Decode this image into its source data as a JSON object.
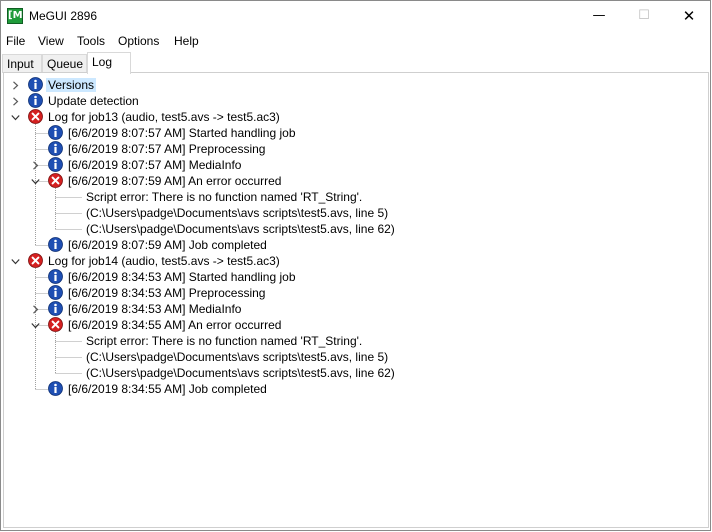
{
  "window": {
    "title": "MeGUI 2896",
    "app_icon_glyph": "[M]",
    "controls": {
      "minimize": "—",
      "maximize": "☐",
      "close": "✕"
    }
  },
  "menu": [
    "File",
    "View",
    "Tools",
    "Options",
    "Help"
  ],
  "tabs": [
    "Input",
    "Queue",
    "Log"
  ],
  "active_tab": "Log",
  "colors": {
    "info": "#1f4fb3",
    "error": "#d42020",
    "selection": "#cce8ff"
  },
  "tree": [
    {
      "label": "Versions",
      "icon": "info-icon",
      "expander": "collapsed",
      "level": 0,
      "selected": true
    },
    {
      "label": "Update detection",
      "icon": "info-icon",
      "expander": "collapsed",
      "level": 0
    },
    {
      "label": "Log for job13 (audio, test5.avs -> test5.ac3)",
      "icon": "error-icon",
      "expander": "expanded",
      "level": 0
    },
    {
      "label": "[6/6/2019 8:07:57 AM] Started handling job",
      "icon": "info-icon",
      "expander": "none",
      "level": 1
    },
    {
      "label": "[6/6/2019 8:07:57 AM] Preprocessing",
      "icon": "info-icon",
      "expander": "none",
      "level": 1
    },
    {
      "label": "[6/6/2019 8:07:57 AM] MediaInfo",
      "icon": "info-icon",
      "expander": "collapsed",
      "level": 1
    },
    {
      "label": "[6/6/2019 8:07:59 AM] An error occurred",
      "icon": "error-icon",
      "expander": "expanded",
      "level": 1
    },
    {
      "label": "Script error: There is no function named 'RT_String'.",
      "icon": "none",
      "expander": "none",
      "level": 2
    },
    {
      "label": "(C:\\Users\\padge\\Documents\\avs scripts\\test5.avs, line 5)",
      "icon": "none",
      "expander": "none",
      "level": 2
    },
    {
      "label": "(C:\\Users\\padge\\Documents\\avs scripts\\test5.avs, line 62)",
      "icon": "none",
      "expander": "none",
      "level": 2
    },
    {
      "label": "[6/6/2019 8:07:59 AM] Job completed",
      "icon": "info-icon",
      "expander": "none",
      "level": 1
    },
    {
      "label": "Log for job14 (audio, test5.avs -> test5.ac3)",
      "icon": "error-icon",
      "expander": "expanded",
      "level": 0
    },
    {
      "label": "[6/6/2019 8:34:53 AM] Started handling job",
      "icon": "info-icon",
      "expander": "none",
      "level": 1
    },
    {
      "label": "[6/6/2019 8:34:53 AM] Preprocessing",
      "icon": "info-icon",
      "expander": "none",
      "level": 1
    },
    {
      "label": "[6/6/2019 8:34:53 AM] MediaInfo",
      "icon": "info-icon",
      "expander": "collapsed",
      "level": 1
    },
    {
      "label": "[6/6/2019 8:34:55 AM] An error occurred",
      "icon": "error-icon",
      "expander": "expanded",
      "level": 1
    },
    {
      "label": "Script error: There is no function named 'RT_String'.",
      "icon": "none",
      "expander": "none",
      "level": 2
    },
    {
      "label": "(C:\\Users\\padge\\Documents\\avs scripts\\test5.avs, line 5)",
      "icon": "none",
      "expander": "none",
      "level": 2
    },
    {
      "label": "(C:\\Users\\padge\\Documents\\avs scripts\\test5.avs, line 62)",
      "icon": "none",
      "expander": "none",
      "level": 2
    },
    {
      "label": "[6/6/2019 8:34:55 AM] Job completed",
      "icon": "info-icon",
      "expander": "none",
      "level": 1
    }
  ]
}
